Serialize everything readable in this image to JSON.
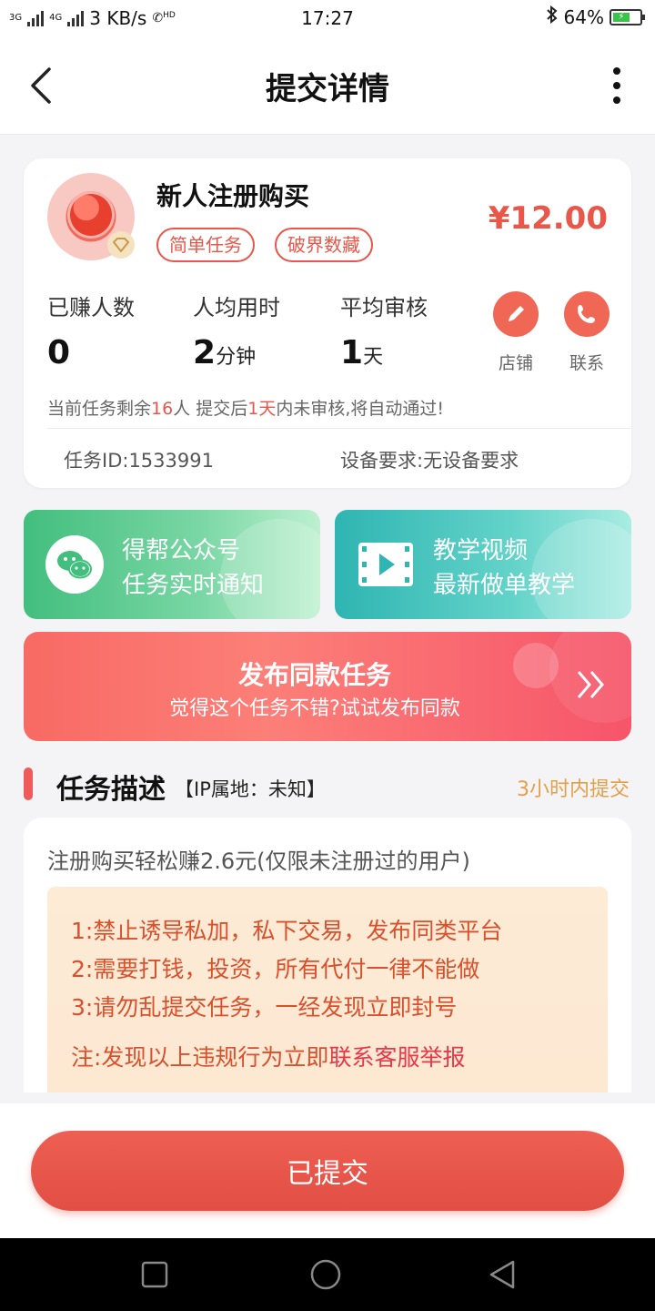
{
  "status_bar": {
    "network_1": "3G",
    "network_2": "4G",
    "speed": "3 KB/s",
    "hd": "HD",
    "time": "17:27",
    "battery": "64%"
  },
  "header": {
    "title": "提交详情"
  },
  "task": {
    "name": "新人注册购买",
    "tags": [
      "简单任务",
      "破界数藏"
    ],
    "price": "¥12.00",
    "stats": [
      {
        "label": "已赚人数",
        "value": "0",
        "unit": ""
      },
      {
        "label": "人均用时",
        "value": "2",
        "unit": "分钟"
      },
      {
        "label": "平均审核",
        "value": "1",
        "unit": "天"
      }
    ],
    "shop_label": "店铺",
    "contact_label": "联系",
    "notice": {
      "p1": "当前任务剩余",
      "remaining": "16",
      "p2": "人  提交后",
      "days": "1天",
      "p3": "内未审核,将自动通过!"
    },
    "task_id": "任务ID:1533991",
    "device": "设备要求:无设备要求"
  },
  "promos": {
    "wechat": {
      "line1": "得帮公众号",
      "line2": "任务实时通知"
    },
    "video": {
      "line1": "教学视频",
      "line2": "最新做单教学"
    }
  },
  "publish": {
    "title": "发布同款任务",
    "subtitle": "觉得这个任务不错?试试发布同款"
  },
  "section": {
    "title": "任务描述",
    "ip": "【IP属地：未知】",
    "deadline": "3小时内提交"
  },
  "description": {
    "text": "注册购买轻松赚2.6元(仅限未注册过的用户)",
    "rules": [
      "1:禁止诱导私加，私下交易，发布同类平台",
      "2:需要打钱，投资，所有代付一律不能做",
      "3:请勿乱提交任务，一经发现立即封号"
    ],
    "note_prefix": "注:发现以上违规行为立即",
    "note_link": "联系客服举报"
  },
  "submit": {
    "label": "已提交"
  },
  "colors": {
    "accent": "#e8574a",
    "wechat": "#42be7e",
    "video": "#2fb5b2",
    "deadline": "#e2a04a"
  }
}
